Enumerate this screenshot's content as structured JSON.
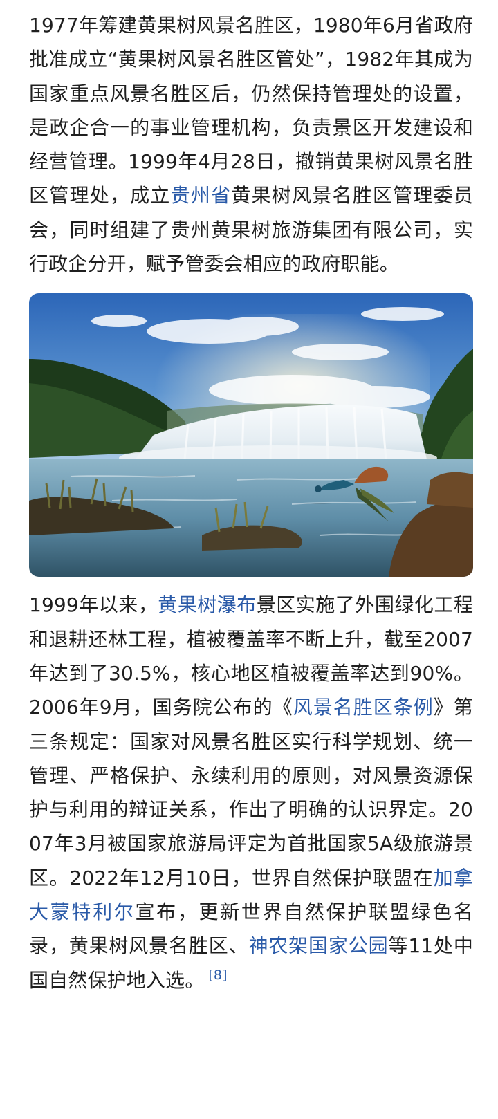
{
  "article": {
    "para1": {
      "text1": "1977年筹建黄果树风景名胜区，1980年6月省政府批准成立“黄果树风景名胜区管处”，1982年其成为国家重点风景名胜区后，仍然保持管理处的设置，是政企合一的事业管理机构，负责景区开发建设和经营管理。1999年4月28日，撤销黄果树风景名胜区管理处，成立",
      "link1": "贵州省",
      "text2": "黄果树风景名胜区管理委员会，同时组建了贵州黄果树旅游集团有限公司，实行政企分开，赋予管委会相应的政府职能。"
    },
    "image": {
      "subject": "黄果树瀑布与孔雀",
      "colors": {
        "sky_top": "#2f6fbe",
        "sky_bottom": "#a9cbe8",
        "forest": "#1e3a1c",
        "water": "#6f9bb4",
        "falls": "#eef3f6"
      }
    },
    "para2": {
      "text1": "1999年以来，",
      "link1": "黄果树瀑布",
      "text2": "景区实施了外围绿化工程和退耕还林工程，植被覆盖率不断上升，截至2007年达到了30.5%，核心地区植被覆盖率达到90%。2006年9月，国务院公布的《",
      "link2": "风景名胜区条例",
      "text3": "》第三条规定：国家对风景名胜区实行科学规划、统一管理、严格保护、永续利用的原则，对风景资源保护与利用的辩证关系，作出了明确的认识界定。2007年3月被国家旅游局评定为首批国家5A级旅游景区。2022年12月10日，世界自然保护联盟在",
      "link3": "加拿大蒙特利尔",
      "text4": "宣布，更新世界自然保护联盟绿色名录，黄果树风景名胜区、",
      "link4": "神农架国家公园",
      "text5": "等11处中国自然保护地入选。",
      "ref": "[8]"
    },
    "link_color": "#2a5aa8"
  }
}
